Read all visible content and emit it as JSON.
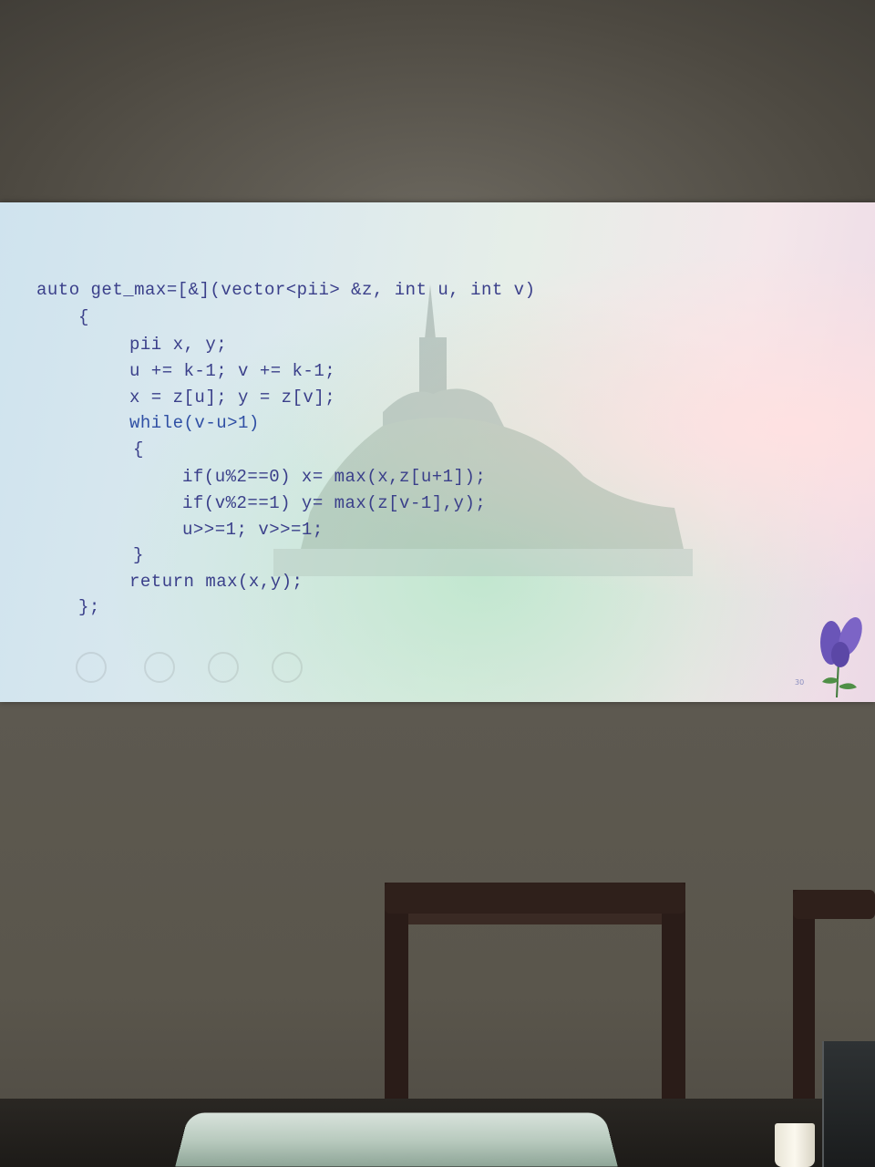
{
  "slide": {
    "code_lines": [
      "auto get_max=[&](vector<pii> &z, int u, int v)",
      "{",
      "pii x, y;",
      "u += k-1; v += k-1;",
      "x = z[u]; y = z[v];",
      "while(v-u>1)",
      "{",
      "if(u%2==0) x= max(x,z[u+1]);",
      "if(v%2==1) y= max(z[v-1],y);",
      "u>>=1; v>>=1;",
      "}",
      "return max(x,y);",
      "};"
    ],
    "page_number": "30"
  },
  "colors": {
    "code_text": "#3a3f8a",
    "function_highlight": "#5d8f3a",
    "wall": "#5a564c",
    "chair_wood": "#2a1c18"
  }
}
